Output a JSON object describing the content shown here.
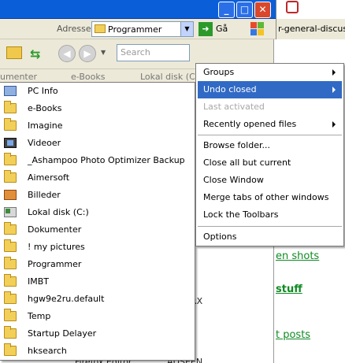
{
  "window": {
    "controls": {
      "minimize": "_",
      "maximize": "□",
      "close": "✕"
    },
    "address_label": "Adresse",
    "address_value": "Programmer",
    "go_label": "Gå",
    "search_placeholder": "Search",
    "partial_title_right": "r-general-discussio",
    "tabs": [
      "umenter",
      "e-Books",
      "Lokal disk (C:)"
    ]
  },
  "folder_menu": {
    "items": [
      {
        "label": "PC Info",
        "icon": "computer-icon"
      },
      {
        "label": "e-Books",
        "icon": "folder-icon"
      },
      {
        "label": "Imagine",
        "icon": "folder-icon"
      },
      {
        "label": "Videoer",
        "icon": "film-icon"
      },
      {
        "label": "_Ashampoo Photo Optimizer Backup",
        "icon": "folder-icon"
      },
      {
        "label": "Aimersoft",
        "icon": "folder-icon"
      },
      {
        "label": "Billeder",
        "icon": "pictures-icon"
      },
      {
        "label": "Lokal disk (C:)",
        "icon": "drive-icon"
      },
      {
        "label": "Dokumenter",
        "icon": "folder-icon"
      },
      {
        "label": "! my pictures",
        "icon": "folder-icon"
      },
      {
        "label": "Programmer",
        "icon": "folder-icon"
      },
      {
        "label": "IMBT",
        "icon": "folder-icon"
      },
      {
        "label": "hgw9e2ru.default",
        "icon": "folder-icon"
      },
      {
        "label": "Temp",
        "icon": "folder-icon"
      },
      {
        "label": "Startup Delayer",
        "icon": "folder-icon"
      },
      {
        "label": "hksearch",
        "icon": "folder-icon"
      }
    ]
  },
  "context_menu": {
    "items": [
      {
        "label": "Groups",
        "submenu": true,
        "state": "normal"
      },
      {
        "label": "Undo closed",
        "submenu": true,
        "state": "highlighted"
      },
      {
        "label": "Last activated",
        "submenu": false,
        "state": "disabled"
      },
      {
        "label": "Recently opened files",
        "submenu": true,
        "state": "normal"
      },
      {
        "label": "Browse folder...",
        "submenu": false,
        "state": "normal"
      },
      {
        "label": "Close all but current",
        "submenu": false,
        "state": "normal"
      },
      {
        "label": "Close Window",
        "submenu": false,
        "state": "normal"
      },
      {
        "label": "Merge tabs of other windows",
        "submenu": false,
        "state": "normal"
      },
      {
        "label": "Lock the Toolbars",
        "submenu": false,
        "state": "normal"
      },
      {
        "label": "Options",
        "submenu": false,
        "state": "normal"
      }
    ]
  },
  "background": {
    "right_links": [
      "en shots",
      "stuff",
      "t posts"
    ],
    "partial_texts": [
      "RX",
      "Firefox Editor",
      "ADSEEN"
    ]
  },
  "colors": {
    "highlight": "#316ac5",
    "title_bar": "#0a5fd8",
    "link_green": "#108a23"
  }
}
